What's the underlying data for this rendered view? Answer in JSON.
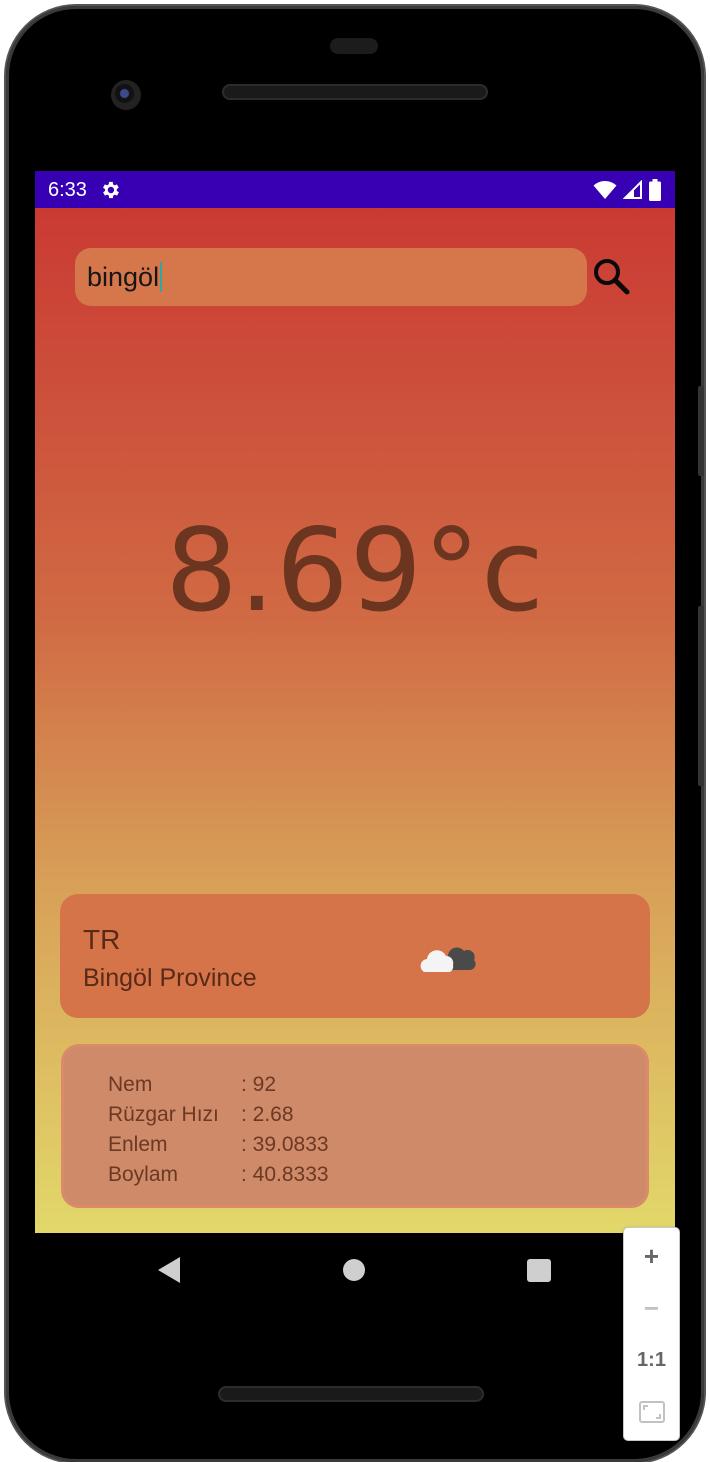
{
  "status_bar": {
    "time": "6:33",
    "background": "#3700b3",
    "icons": [
      "gear-icon",
      "wifi-icon",
      "signal-icon",
      "battery-icon"
    ]
  },
  "search": {
    "value": "bingöl",
    "background": "#d5764b"
  },
  "weather": {
    "temperature": "8.69°c",
    "country": "TR",
    "province": "Bingöl Province",
    "icon": "cloud-icon"
  },
  "details": [
    {
      "label": "Nem",
      "value": ": 92"
    },
    {
      "label": "Rüzgar Hızı",
      "value": ": 2.68"
    },
    {
      "label": "Enlem",
      "value": ": 39.0833"
    },
    {
      "label": "Boylam",
      "value": ": 40.8333"
    }
  ],
  "nav_bar": [
    "back-icon",
    "home-icon",
    "recents-icon"
  ],
  "zoom_panel": {
    "zoom_in": "+",
    "zoom_out": "−",
    "actual_size": "1:1",
    "fit_icon": "fit-screen-icon"
  },
  "colors": {
    "gradient_top": "#ca3a33",
    "gradient_bottom": "#e2d86a",
    "card": "#d57449",
    "details_card": "#ce8a69",
    "temperature_text": "#6b3520"
  }
}
